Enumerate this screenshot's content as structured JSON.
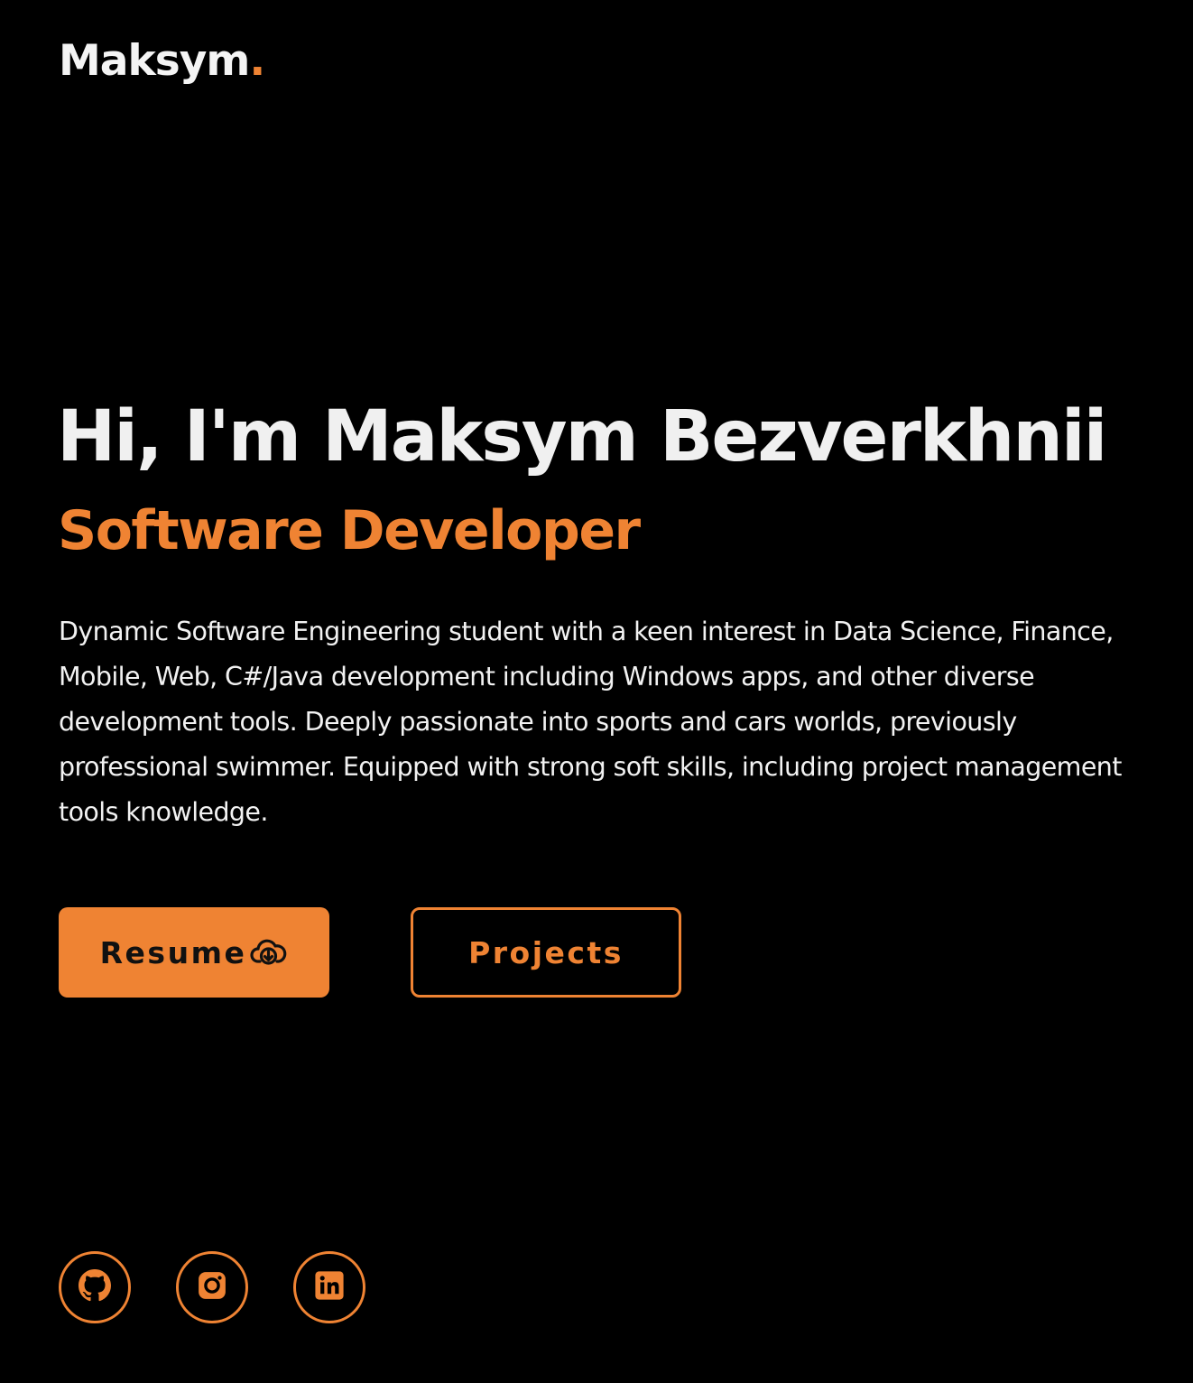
{
  "header": {
    "logo_text": "Maksym",
    "logo_dot": "."
  },
  "hero": {
    "title": "Hi, I'm Maksym Bezverkhnii",
    "subtitle": "Software Developer",
    "description": "Dynamic Software Engineering student with a keen interest in Data Science, Finance, Mobile, Web, C#/Java development including Windows apps, and other diverse development tools. Deeply passionate into sports and cars worlds, previously professional swimmer. Equipped with strong soft skills, including project management tools knowledge."
  },
  "buttons": {
    "resume_label": "Resume",
    "resume_icon": "cloud-download-icon",
    "projects_label": "Projects"
  },
  "social_links": [
    {
      "name": "github",
      "icon": "github-icon"
    },
    {
      "name": "instagram",
      "icon": "instagram-icon"
    },
    {
      "name": "linkedin",
      "icon": "linkedin-icon"
    }
  ],
  "colors": {
    "background": "#000000",
    "accent": "#ef8333",
    "text": "#f2f2f2"
  }
}
